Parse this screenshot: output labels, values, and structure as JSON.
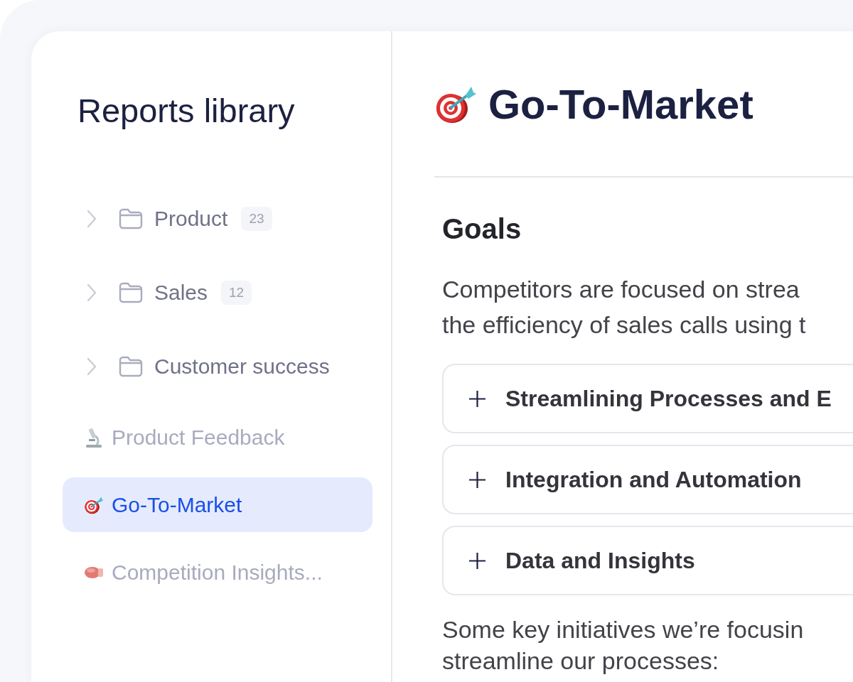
{
  "sidebar": {
    "title": "Reports library",
    "items": [
      {
        "kind": "folder",
        "label": "Product",
        "count": "23",
        "expanded": false,
        "selected": false
      },
      {
        "kind": "folder",
        "label": "Sales",
        "count": "12",
        "expanded": false,
        "selected": false
      },
      {
        "kind": "folder",
        "label": "Customer success",
        "expanded": false,
        "selected": false
      },
      {
        "kind": "report",
        "label": "Product Feedback",
        "selected": false
      },
      {
        "kind": "report",
        "label": "Go-To-Market",
        "selected": true
      },
      {
        "kind": "report",
        "label": "Competition Insights...",
        "selected": false
      }
    ]
  },
  "document": {
    "title": "Go-To-Market",
    "heading": "Goals",
    "intro": [
      "Competitors are focused on strea",
      "the efficiency of sales calls using t"
    ],
    "accordion": [
      {
        "title": "Streamlining Processes and E",
        "expanded": false
      },
      {
        "title": "Integration and Automation",
        "expanded": false
      },
      {
        "title": "Data and Insights",
        "expanded": false
      }
    ],
    "outro": [
      "Some key initiatives we’re focusin",
      "streamline our processes:"
    ]
  }
}
